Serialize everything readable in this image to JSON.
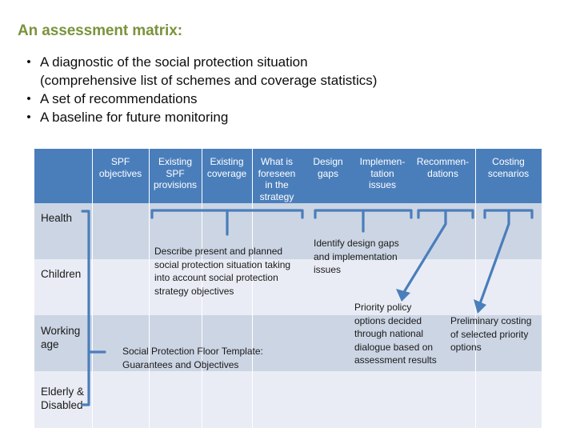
{
  "slide": {
    "title": "An assessment matrix:",
    "title_color": "#7b933c",
    "bullet_marker": "•",
    "bullets": [
      "A diagnostic of the social protection situation (comprehensive list of schemes and coverage statistics)",
      "A set of recommendations",
      "A baseline for future monitoring"
    ],
    "bullet_lines": [
      [
        "A diagnostic of the social protection situation",
        "(comprehensive list of schemes and coverage statistics)"
      ],
      [
        "A set of recommendations"
      ],
      [
        "A baseline for future monitoring"
      ]
    ]
  },
  "matrix": {
    "header_bg": "#4a7ebb",
    "row_band_dark": "#ccd5e4",
    "row_band_light": "#e9ecf4",
    "connector_color": "#4a7ebb",
    "columns": [
      {
        "label": ""
      },
      {
        "label": "SPF objectives"
      },
      {
        "label": "Existing SPF provisions"
      },
      {
        "label": "Existing coverage"
      },
      {
        "label": "What is foreseen in the strategy"
      },
      {
        "label": "Design gaps"
      },
      {
        "label": "Implemen- tation issues"
      },
      {
        "label": "Recommen- dations"
      },
      {
        "label": "Costing scenarios"
      }
    ],
    "column_label_lines": [
      [],
      [
        "SPF",
        "objectives"
      ],
      [
        "Existing",
        "SPF",
        "provisions"
      ],
      [
        "Existing",
        "coverage"
      ],
      [
        "What is",
        "foreseen",
        "in the",
        "strategy"
      ],
      [
        "Design",
        "gaps"
      ],
      [
        "Implemen-",
        "tation",
        "issues"
      ],
      [
        "Recommen-",
        "dations"
      ],
      [
        "Costing",
        "scenarios"
      ]
    ],
    "rows": [
      {
        "label_lines": [
          "Health"
        ]
      },
      {
        "label_lines": [
          "Children"
        ]
      },
      {
        "label_lines": [
          "Working",
          "age"
        ]
      },
      {
        "label_lines": [
          "Elderly &",
          "Disabled"
        ]
      }
    ],
    "annotations": [
      {
        "name": "describe-situation",
        "lines": [
          "Describe present and planned",
          "social protection situation taking",
          "into account social protection",
          "strategy objectives"
        ]
      },
      {
        "name": "identify-gaps",
        "lines": [
          "Identify design gaps",
          "and implementation",
          "issues"
        ]
      },
      {
        "name": "priority-policy-options",
        "lines": [
          "Priority policy",
          "options decided",
          "through national",
          "dialogue based on",
          "assessment results"
        ]
      },
      {
        "name": "preliminary-costing",
        "lines": [
          "Preliminary costing",
          "of selected priority",
          "options"
        ]
      },
      {
        "name": "spf-template",
        "lines": [
          "Social Protection Floor Template:",
          "Guarantees and Objectives"
        ]
      }
    ]
  }
}
